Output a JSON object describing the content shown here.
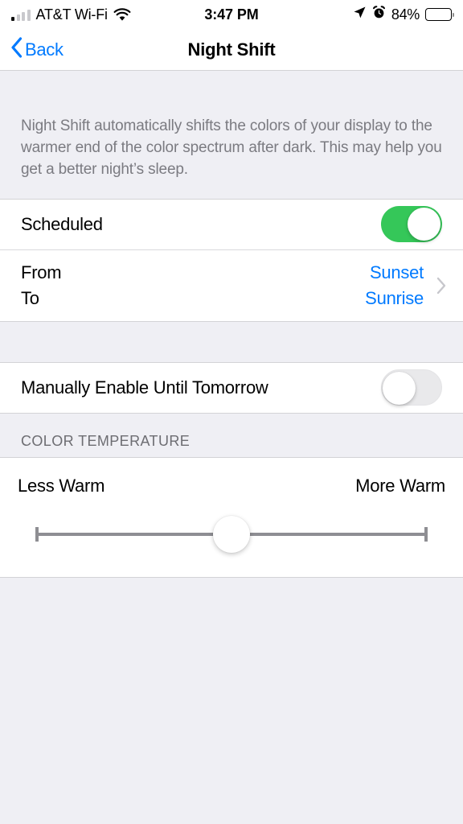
{
  "status_bar": {
    "carrier": "AT&T Wi-Fi",
    "signal_icon": "signal-bars-icon",
    "signal_bars_filled": 1,
    "signal_bars_total": 4,
    "wifi_icon": "wifi-icon",
    "time": "3:47 PM",
    "location_icon": "location-arrow-icon",
    "alarm_icon": "alarm-clock-icon",
    "battery_percent": "84%",
    "battery_level": 84,
    "battery_icon": "battery-icon"
  },
  "nav": {
    "back_label": "Back",
    "back_icon": "chevron-left-icon",
    "title": "Night Shift"
  },
  "description": "Night Shift automatically shifts the colors of your display to the warmer end of the color spectrum after dark. This may help you get a better night’s sleep.",
  "scheduled": {
    "label": "Scheduled",
    "toggle_state": "on"
  },
  "schedule": {
    "from_label": "From",
    "to_label": "To",
    "from_value": "Sunset",
    "to_value": "Sunrise",
    "disclosure_icon": "chevron-right-icon"
  },
  "manual": {
    "label": "Manually Enable Until Tomorrow",
    "toggle_state": "off"
  },
  "color_temperature": {
    "section_header": "COLOR TEMPERATURE",
    "less_label": "Less Warm",
    "more_label": "More Warm",
    "slider_value_percent": 50
  },
  "colors": {
    "accent_blue": "#007aff",
    "toggle_on_green": "#35c759",
    "toggle_off_gray": "#e9e9eb",
    "page_background": "#efeff4",
    "card_background": "#ffffff",
    "secondary_text": "#6d6d72",
    "slider_track": "#8e8e93"
  }
}
